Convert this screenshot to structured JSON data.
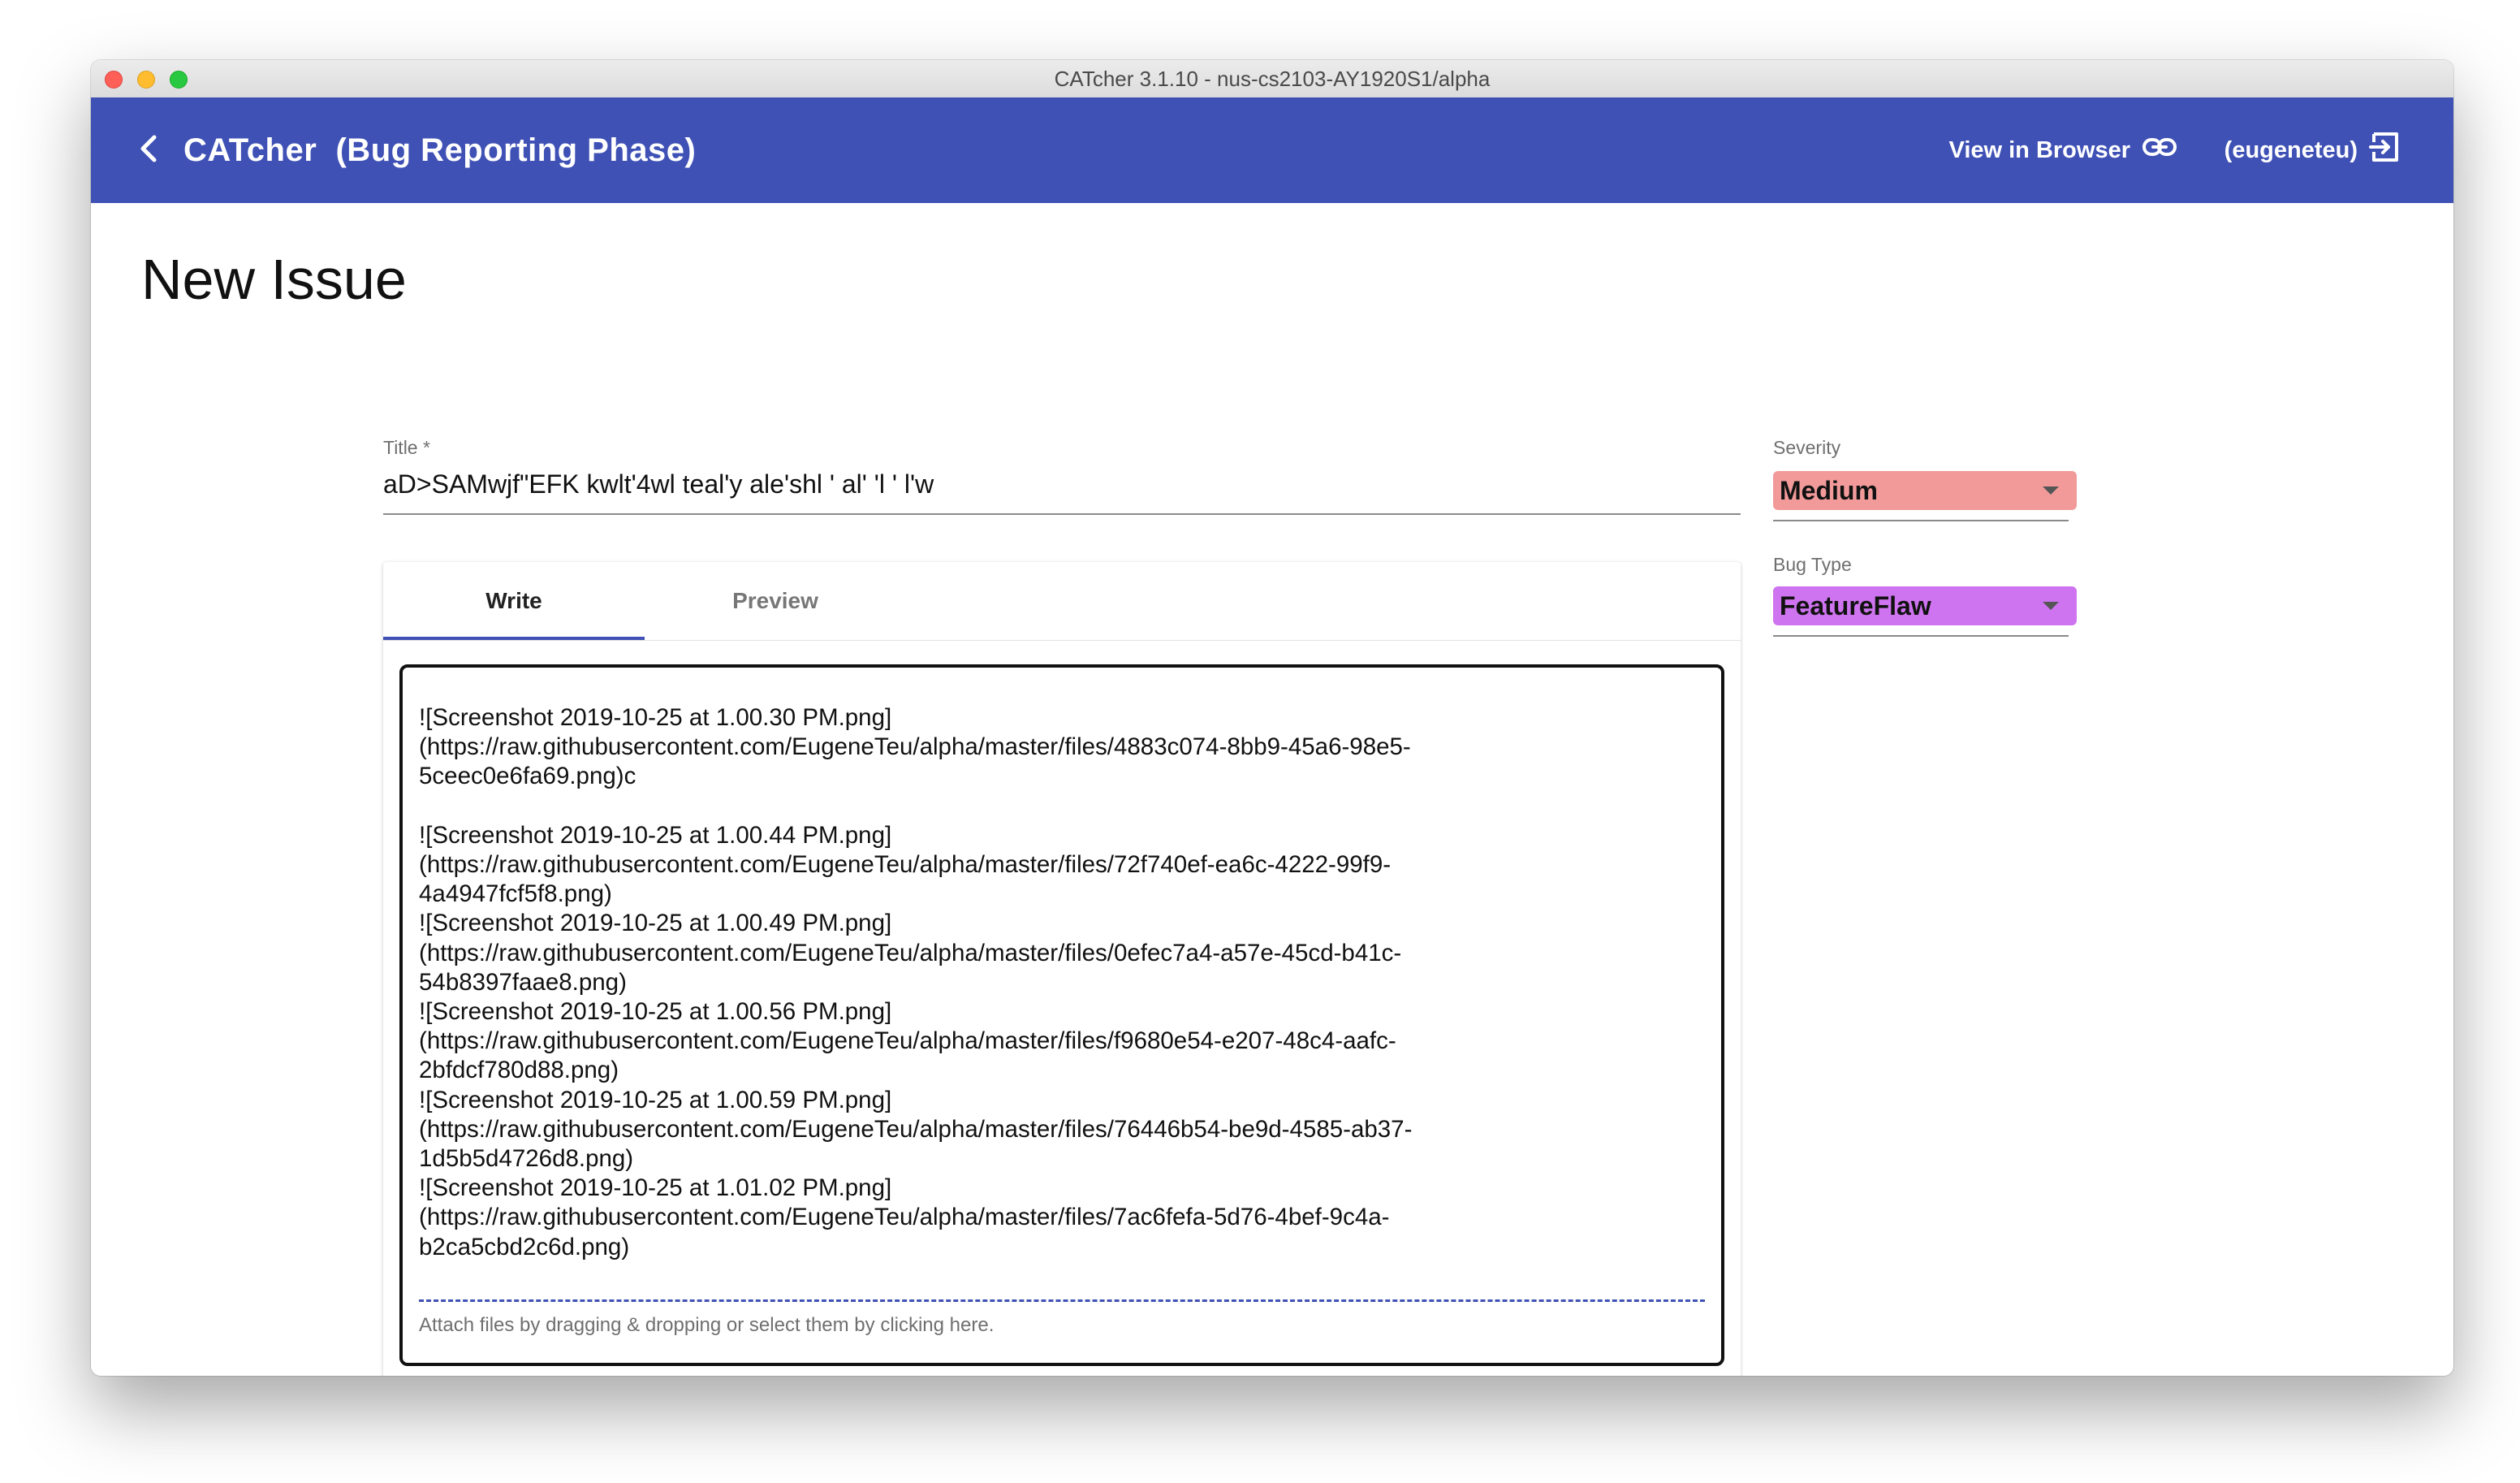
{
  "window": {
    "title": "CATcher 3.1.10 - nus-cs2103-AY1920S1/alpha"
  },
  "appbar": {
    "title": "CATcher  (Bug Reporting Phase)",
    "view_in_browser": "View in Browser",
    "user": "(eugeneteu)",
    "color": "#3f51b5"
  },
  "page": {
    "heading": "New Issue"
  },
  "form": {
    "title_label": "Title *",
    "title_value": "aD>SAMwjf\"EFK kwlt'4wl teal'y ale'shl ' al' 'l ' l'w",
    "severity_label": "Severity",
    "severity_value": "Medium",
    "severity_color": "#f29a9a",
    "bug_type_label": "Bug Type",
    "bug_type_value": "FeatureFlaw",
    "bug_type_color": "#cf74f0"
  },
  "editor": {
    "tabs": [
      "Write",
      "Preview"
    ],
    "active_tab": "Write",
    "description": "![Screenshot 2019-10-25 at 1.00.30 PM.png]\n(https://raw.githubusercontent.com/EugeneTeu/alpha/master/files/4883c074-8bb9-45a6-98e5-\n5ceec0e6fa69.png)c\n\n![Screenshot 2019-10-25 at 1.00.44 PM.png]\n(https://raw.githubusercontent.com/EugeneTeu/alpha/master/files/72f740ef-ea6c-4222-99f9-\n4a4947fcf5f8.png)\n![Screenshot 2019-10-25 at 1.00.49 PM.png]\n(https://raw.githubusercontent.com/EugeneTeu/alpha/master/files/0efec7a4-a57e-45cd-b41c-\n54b8397faae8.png)\n![Screenshot 2019-10-25 at 1.00.56 PM.png]\n(https://raw.githubusercontent.com/EugeneTeu/alpha/master/files/f9680e54-e207-48c4-aafc-\n2bfdcf780d88.png)\n![Screenshot 2019-10-25 at 1.00.59 PM.png]\n(https://raw.githubusercontent.com/EugeneTeu/alpha/master/files/76446b54-be9d-4585-ab37-\n1d5b5d4726d8.png)\n![Screenshot 2019-10-25 at 1.01.02 PM.png]\n(https://raw.githubusercontent.com/EugeneTeu/alpha/master/files/7ac6fefa-5d76-4bef-9c4a-\nb2ca5cbd2c6d.png)",
    "attach_hint": "Attach files by dragging & dropping or select them by clicking here."
  },
  "icons": {
    "back": "chevron-left-icon",
    "link": "link-icon",
    "logout": "logout-icon",
    "dropdown": "dropdown-arrow-icon"
  }
}
